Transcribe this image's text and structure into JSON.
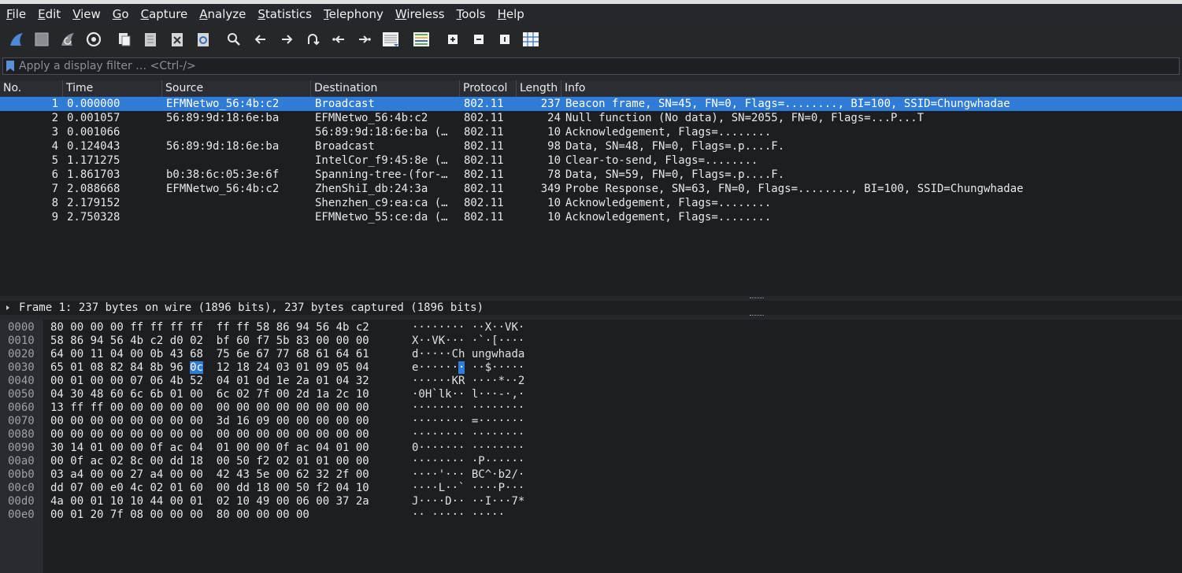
{
  "menu": [
    {
      "label": "File",
      "u": "F",
      "rest": "ile"
    },
    {
      "label": "Edit",
      "u": "E",
      "rest": "dit"
    },
    {
      "label": "View",
      "u": "V",
      "rest": "iew"
    },
    {
      "label": "Go",
      "u": "G",
      "rest": "o"
    },
    {
      "label": "Capture",
      "u": "C",
      "rest": "apture"
    },
    {
      "label": "Analyze",
      "u": "A",
      "rest": "nalyze"
    },
    {
      "label": "Statistics",
      "u": "S",
      "rest": "tatistics"
    },
    {
      "label": "Telephony",
      "u": "T",
      "rest": "elephony"
    },
    {
      "label": "Wireless",
      "u": "W",
      "rest": "ireless"
    },
    {
      "label": "Tools",
      "u": "T",
      "rest": "ools"
    },
    {
      "label": "Help",
      "u": "H",
      "rest": "elp"
    }
  ],
  "toolbar": [
    "start-capture-icon",
    "stop-capture-icon",
    "restart-capture-icon",
    "capture-options-icon",
    "open-file-icon",
    "save-file-icon",
    "close-file-icon",
    "reload-file-icon",
    "find-packet-icon",
    "go-back-icon",
    "go-forward-icon",
    "go-to-packet-icon",
    "first-packet-icon",
    "last-packet-icon",
    "auto-scroll-icon",
    "colorize-icon",
    "zoom-in-icon",
    "zoom-out-icon",
    "normal-size-icon",
    "resize-columns-icon"
  ],
  "filter": {
    "placeholder": "Apply a display filter … <Ctrl-/>"
  },
  "columns": {
    "no": "No.",
    "time": "Time",
    "source": "Source",
    "destination": "Destination",
    "protocol": "Protocol",
    "length": "Length",
    "info": "Info"
  },
  "packets": [
    {
      "no": "1",
      "time": "0.000000",
      "source": "EFMNetwo_56:4b:c2",
      "destination": "Broadcast",
      "protocol": "802.11",
      "length": "237",
      "info": "Beacon frame, SN=45, FN=0, Flags=........, BI=100, SSID=Chungwhadae",
      "selected": true
    },
    {
      "no": "2",
      "time": "0.001057",
      "source": "56:89:9d:18:6e:ba",
      "destination": "EFMNetwo_56:4b:c2",
      "protocol": "802.11",
      "length": "24",
      "info": "Null function (No data), SN=2055, FN=0, Flags=...P...T",
      "selected": false
    },
    {
      "no": "3",
      "time": "0.001066",
      "source": "",
      "destination": "56:89:9d:18:6e:ba (…",
      "protocol": "802.11",
      "length": "10",
      "info": "Acknowledgement, Flags=........",
      "selected": false
    },
    {
      "no": "4",
      "time": "0.124043",
      "source": "56:89:9d:18:6e:ba",
      "destination": "Broadcast",
      "protocol": "802.11",
      "length": "98",
      "info": "Data, SN=48, FN=0, Flags=.p....F.",
      "selected": false
    },
    {
      "no": "5",
      "time": "1.171275",
      "source": "",
      "destination": "IntelCor_f9:45:8e (…",
      "protocol": "802.11",
      "length": "10",
      "info": "Clear-to-send, Flags=........",
      "selected": false
    },
    {
      "no": "6",
      "time": "1.861703",
      "source": "b0:38:6c:05:3e:6f",
      "destination": "Spanning-tree-(for-…",
      "protocol": "802.11",
      "length": "78",
      "info": "Data, SN=59, FN=0, Flags=.p....F.",
      "selected": false
    },
    {
      "no": "7",
      "time": "2.088668",
      "source": "EFMNetwo_56:4b:c2",
      "destination": "ZhenShiI_db:24:3a",
      "protocol": "802.11",
      "length": "349",
      "info": "Probe Response, SN=63, FN=0, Flags=........, BI=100, SSID=Chungwhadae",
      "selected": false
    },
    {
      "no": "8",
      "time": "2.179152",
      "source": "",
      "destination": "Shenzhen_c9:ea:ca (…",
      "protocol": "802.11",
      "length": "10",
      "info": "Acknowledgement, Flags=........",
      "selected": false
    },
    {
      "no": "9",
      "time": "2.750328",
      "source": "",
      "destination": "EFMNetwo_55:ce:da (…",
      "protocol": "802.11",
      "length": "10",
      "info": "Acknowledgement, Flags=........",
      "selected": false
    }
  ],
  "details": {
    "frame_summary": "Frame 1: 237 bytes on wire (1896 bits), 237 bytes captured (1896 bits)"
  },
  "hex": [
    {
      "offset": "0000",
      "bytes": [
        "80",
        "00",
        "00",
        "00",
        "ff",
        "ff",
        "ff",
        "ff",
        "ff",
        "ff",
        "58",
        "86",
        "94",
        "56",
        "4b",
        "c2"
      ],
      "ascii1": "········",
      "ascii2": "··X··VK·"
    },
    {
      "offset": "0010",
      "bytes": [
        "58",
        "86",
        "94",
        "56",
        "4b",
        "c2",
        "d0",
        "02",
        "bf",
        "60",
        "f7",
        "5b",
        "83",
        "00",
        "00",
        "00"
      ],
      "ascii1": "X··VK···",
      "ascii2": "·`·[····"
    },
    {
      "offset": "0020",
      "bytes": [
        "64",
        "00",
        "11",
        "04",
        "00",
        "0b",
        "43",
        "68",
        "75",
        "6e",
        "67",
        "77",
        "68",
        "61",
        "64",
        "61"
      ],
      "ascii1": "d·····Ch",
      "ascii2": "ungwhada"
    },
    {
      "offset": "0030",
      "bytes": [
        "65",
        "01",
        "08",
        "82",
        "84",
        "8b",
        "96",
        "0c",
        "12",
        "18",
        "24",
        "03",
        "01",
        "09",
        "05",
        "04"
      ],
      "ascii1": "e·······",
      "ascii2": "··$·····",
      "hl": 7
    },
    {
      "offset": "0040",
      "bytes": [
        "00",
        "01",
        "00",
        "00",
        "07",
        "06",
        "4b",
        "52",
        "04",
        "01",
        "0d",
        "1e",
        "2a",
        "01",
        "04",
        "32"
      ],
      "ascii1": "······KR",
      "ascii2": "····*··2"
    },
    {
      "offset": "0050",
      "bytes": [
        "04",
        "30",
        "48",
        "60",
        "6c",
        "6b",
        "01",
        "00",
        "6c",
        "02",
        "7f",
        "00",
        "2d",
        "1a",
        "2c",
        "10"
      ],
      "ascii1": "·0H`lk··",
      "ascii2": "l···-·,·"
    },
    {
      "offset": "0060",
      "bytes": [
        "13",
        "ff",
        "ff",
        "00",
        "00",
        "00",
        "00",
        "00",
        "00",
        "00",
        "00",
        "00",
        "00",
        "00",
        "00",
        "00"
      ],
      "ascii1": "········",
      "ascii2": "········"
    },
    {
      "offset": "0070",
      "bytes": [
        "00",
        "00",
        "00",
        "00",
        "00",
        "00",
        "00",
        "00",
        "3d",
        "16",
        "09",
        "00",
        "00",
        "00",
        "00",
        "00"
      ],
      "ascii1": "········",
      "ascii2": "=·······"
    },
    {
      "offset": "0080",
      "bytes": [
        "00",
        "00",
        "00",
        "00",
        "00",
        "00",
        "00",
        "00",
        "00",
        "00",
        "00",
        "00",
        "00",
        "00",
        "00",
        "00"
      ],
      "ascii1": "········",
      "ascii2": "········"
    },
    {
      "offset": "0090",
      "bytes": [
        "30",
        "14",
        "01",
        "00",
        "00",
        "0f",
        "ac",
        "04",
        "01",
        "00",
        "00",
        "0f",
        "ac",
        "04",
        "01",
        "00"
      ],
      "ascii1": "0·······",
      "ascii2": "········"
    },
    {
      "offset": "00a0",
      "bytes": [
        "00",
        "0f",
        "ac",
        "02",
        "8c",
        "00",
        "dd",
        "18",
        "00",
        "50",
        "f2",
        "02",
        "01",
        "01",
        "00",
        "00"
      ],
      "ascii1": "········",
      "ascii2": "·P······"
    },
    {
      "offset": "00b0",
      "bytes": [
        "03",
        "a4",
        "00",
        "00",
        "27",
        "a4",
        "00",
        "00",
        "42",
        "43",
        "5e",
        "00",
        "62",
        "32",
        "2f",
        "00"
      ],
      "ascii1": "····'···",
      "ascii2": "BC^·b2/·"
    },
    {
      "offset": "00c0",
      "bytes": [
        "dd",
        "07",
        "00",
        "e0",
        "4c",
        "02",
        "01",
        "60",
        "00",
        "dd",
        "18",
        "00",
        "50",
        "f2",
        "04",
        "10"
      ],
      "ascii1": "····L··`",
      "ascii2": "····P···"
    },
    {
      "offset": "00d0",
      "bytes": [
        "4a",
        "00",
        "01",
        "10",
        "10",
        "44",
        "00",
        "01",
        "02",
        "10",
        "49",
        "00",
        "06",
        "00",
        "37",
        "2a"
      ],
      "ascii1": "J····D··",
      "ascii2": "··I···7*"
    },
    {
      "offset": "00e0",
      "bytes": [
        "00",
        "01",
        "20",
        "7f",
        "08",
        "00",
        "00",
        "00",
        "80",
        "00",
        "00",
        "00",
        "00"
      ],
      "ascii1": "·· ·····",
      "ascii2": "·····"
    }
  ]
}
